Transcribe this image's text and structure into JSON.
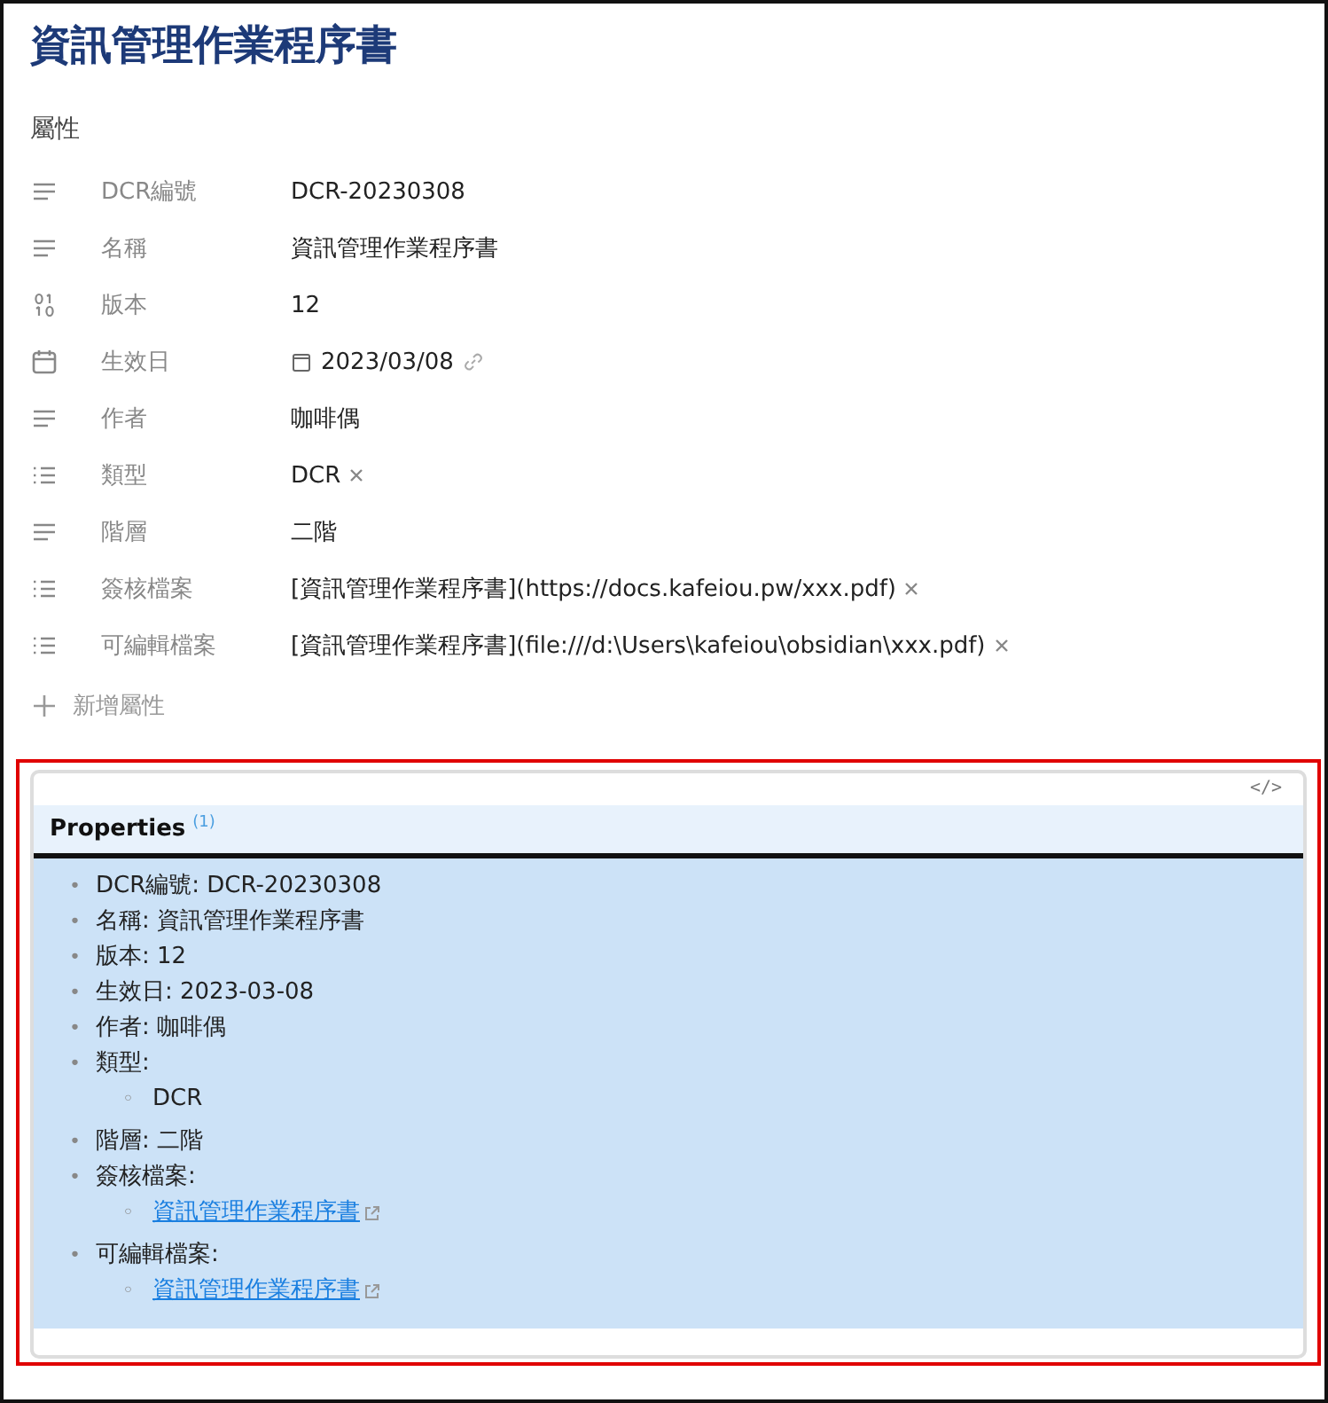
{
  "title": "資訊管理作業程序書",
  "properties_heading": "屬性",
  "properties": [
    {
      "name": "DCR編號",
      "kind": "text",
      "value": "DCR-20230308"
    },
    {
      "name": "名稱",
      "kind": "text",
      "value": "資訊管理作業程序書"
    },
    {
      "name": "版本",
      "kind": "number",
      "value": "12"
    },
    {
      "name": "生效日",
      "kind": "date",
      "value": "2023/03/08"
    },
    {
      "name": "作者",
      "kind": "text",
      "value": "咖啡偶"
    },
    {
      "name": "類型",
      "kind": "list",
      "values": [
        "DCR"
      ]
    },
    {
      "name": "階層",
      "kind": "text",
      "value": "二階"
    },
    {
      "name": "簽核檔案",
      "kind": "list",
      "values": [
        "[資訊管理作業程序書](https://docs.kafeiou.pw/xxx.pdf)"
      ]
    },
    {
      "name": "可編輯檔案",
      "kind": "list",
      "values": [
        "[資訊管理作業程序書](file:///d:\\Users\\kafeiou\\obsidian\\xxx.pdf)"
      ]
    }
  ],
  "add_property": "新增屬性",
  "block": {
    "code_toggle": "</>",
    "heading": "Properties",
    "footnote": "(1)",
    "marker": "•",
    "sub_marker": "◦",
    "items": [
      {
        "text": "DCR編號: DCR-20230308"
      },
      {
        "text": "名稱: 資訊管理作業程序書"
      },
      {
        "text": "版本: 12"
      },
      {
        "text": "生效日: 2023-03-08"
      },
      {
        "text": "作者: 咖啡偶"
      },
      {
        "text": "類型:",
        "children": [
          {
            "kind": "text",
            "text": "DCR"
          }
        ]
      },
      {
        "text": "階層: 二階"
      },
      {
        "text": "簽核檔案:",
        "children": [
          {
            "kind": "link",
            "text": "資訊管理作業程序書"
          }
        ]
      },
      {
        "text": "可編輯檔案:",
        "children": [
          {
            "kind": "link",
            "text": "資訊管理作業程序書"
          }
        ]
      }
    ]
  }
}
